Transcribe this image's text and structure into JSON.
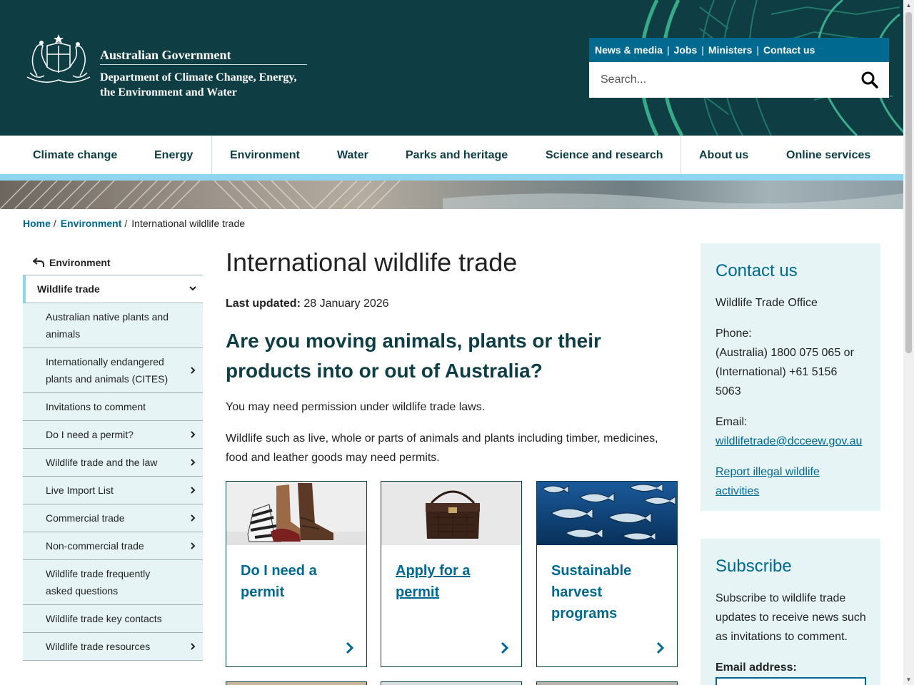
{
  "header": {
    "gov_name": "Australian Government",
    "dept_name": "Department of Climate Change, Energy, the Environment and Water",
    "utility_links": [
      "News & media",
      "Jobs",
      "Ministers",
      "Contact us"
    ],
    "search_placeholder": "Search...",
    "search_icon": "magnifier-icon"
  },
  "mainnav": {
    "items": [
      "Climate change",
      "Energy",
      "Environment",
      "Water",
      "Parks and heritage",
      "Science and research",
      "About us",
      "Online services"
    ]
  },
  "breadcrumb": {
    "items": [
      "Home",
      "Environment"
    ],
    "current": "International wildlife trade"
  },
  "sidenav": {
    "parent": "Environment",
    "active": "Wildlife trade",
    "items": [
      "Australian native plants and animals",
      "Internationally endangered plants and animals (CITES)",
      "Invitations to comment",
      "Do I need a permit?",
      "Wildlife trade and the law",
      "Live Import List",
      "Commercial trade",
      "Non-commercial trade",
      "Wildlife trade frequently asked questions",
      "Wildlife trade key contacts",
      "Wildlife trade resources"
    ]
  },
  "main": {
    "title": "International wildlife trade",
    "last_updated_label": "Last updated:",
    "last_updated_value": "28 January 2026",
    "subheading": "Are you moving animals, plants or their products into or out of Australia?",
    "para1": "You may need permission under wildlife trade laws.",
    "para2": "Wildlife such as live, whole or parts of animals and plants including timber, medicines, food and leather goods may need permits.",
    "cards": [
      {
        "title": "Do I need a permit",
        "image": "boots-image"
      },
      {
        "title": "Apply for a permit",
        "image": "handbag-image"
      },
      {
        "title": "Sustainable harvest programs",
        "image": "tuna-image"
      }
    ]
  },
  "contact": {
    "heading": "Contact us",
    "office": "Wildlife Trade Office",
    "phone_label": "Phone:",
    "phone_au": "(Australia) 1800 075 065 or",
    "phone_intl": "(International) +61 5156 5063",
    "email_label": "Email:",
    "email": "wildlifetrade@dcceew.gov.au",
    "report_link": "Report illegal wildlife activities"
  },
  "subscribe": {
    "heading": "Subscribe",
    "text": "Subscribe to wildlife trade updates to receive news such as invitations to comment.",
    "email_label": "Email address:"
  },
  "colors": {
    "header_bg": "#0e3e44",
    "accent": "#00698f",
    "panel_bg": "#e6f4f6",
    "nav_stripe": "#8fd4f0"
  }
}
